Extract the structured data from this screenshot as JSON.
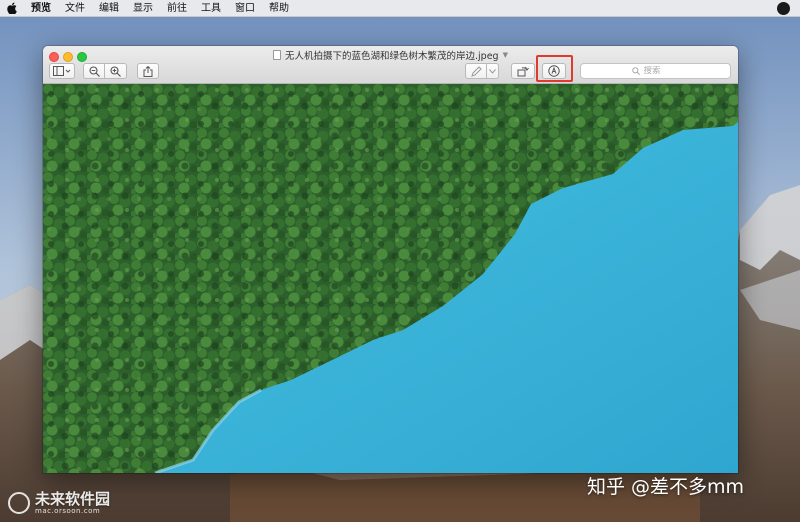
{
  "menubar": {
    "app_name": "预览",
    "items": [
      "文件",
      "编辑",
      "显示",
      "前往",
      "工具",
      "窗口",
      "帮助"
    ]
  },
  "window": {
    "title": "无人机拍摄下的蓝色湖和绿色树木繁茂的岸边.jpeg",
    "toolbar": {
      "sidebar_icon": "sidebar-toggle-icon",
      "zoom_out_icon": "zoom-out-icon",
      "zoom_in_icon": "zoom-in-icon",
      "share_icon": "share-icon",
      "pen_icon": "pen-icon",
      "rotate_icon": "rotate-icon",
      "markup_icon": "markup-toolbar-icon"
    },
    "search": {
      "placeholder": "搜索"
    }
  },
  "colors": {
    "highlight": "#e0392f",
    "lake": "#39b3d8",
    "forest": "#2f6a2e"
  },
  "watermarks": {
    "zhihu": "知乎 @差不多mm",
    "site_name": "未来软件园",
    "site_url": "mac.orsoon.com"
  }
}
